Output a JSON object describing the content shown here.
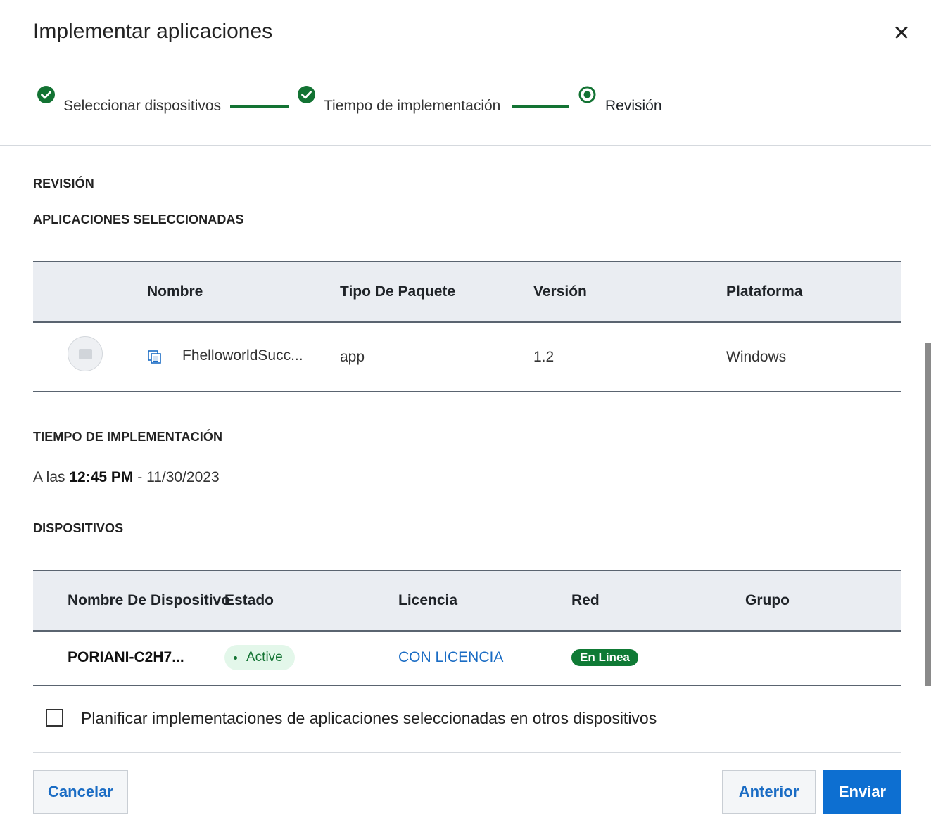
{
  "dialog": {
    "title": "Implementar aplicaciones",
    "close_glyph": "✕"
  },
  "stepper": {
    "steps": [
      {
        "label": "Seleccionar dispositivos",
        "state": "completed"
      },
      {
        "label": "Tiempo de implementación",
        "state": "completed"
      },
      {
        "label": "Revisión",
        "state": "current"
      }
    ],
    "color": "#137333"
  },
  "review": {
    "section_title": "REVISIÓN",
    "apps_title": "APLICACIONES SELECCIONADAS",
    "apps_table": {
      "headers": [
        "Nombre",
        "Tipo De Paquete",
        "Versión",
        "Plataforma"
      ],
      "rows": [
        {
          "name": "FhelloworldSucc...",
          "package_type": "app",
          "version": "1.2",
          "platform": "Windows",
          "icon": "package-icon"
        }
      ]
    },
    "time_title": "TIEMPO DE IMPLEMENTACIÓN",
    "time": {
      "prefix": "A las",
      "time": "12:45 PM",
      "separator": "-",
      "date": "11/30/2023"
    },
    "devices_title": "DISPOSITIVOS",
    "devices_table": {
      "headers": [
        "Nombre De Dispositivo",
        "Estado",
        "Licencia",
        "Red",
        "Grupo"
      ],
      "rows": [
        {
          "name": "PORIANI-C2H7...",
          "status": "Active",
          "license": "CON LICENCIA",
          "network": "En Línea",
          "group": ""
        }
      ]
    }
  },
  "options": {
    "schedule_other_devices_label": "Planificar implementaciones de aplicaciones seleccionadas en otros dispositivos",
    "checked": false
  },
  "footer": {
    "cancel_label": "Cancelar",
    "previous_label": "Anterior",
    "submit_label": "Enviar"
  },
  "colors": {
    "primary": "#0d6fd1",
    "link": "#1a6cc4",
    "success": "#137333",
    "header_bg": "#eaedf2"
  }
}
